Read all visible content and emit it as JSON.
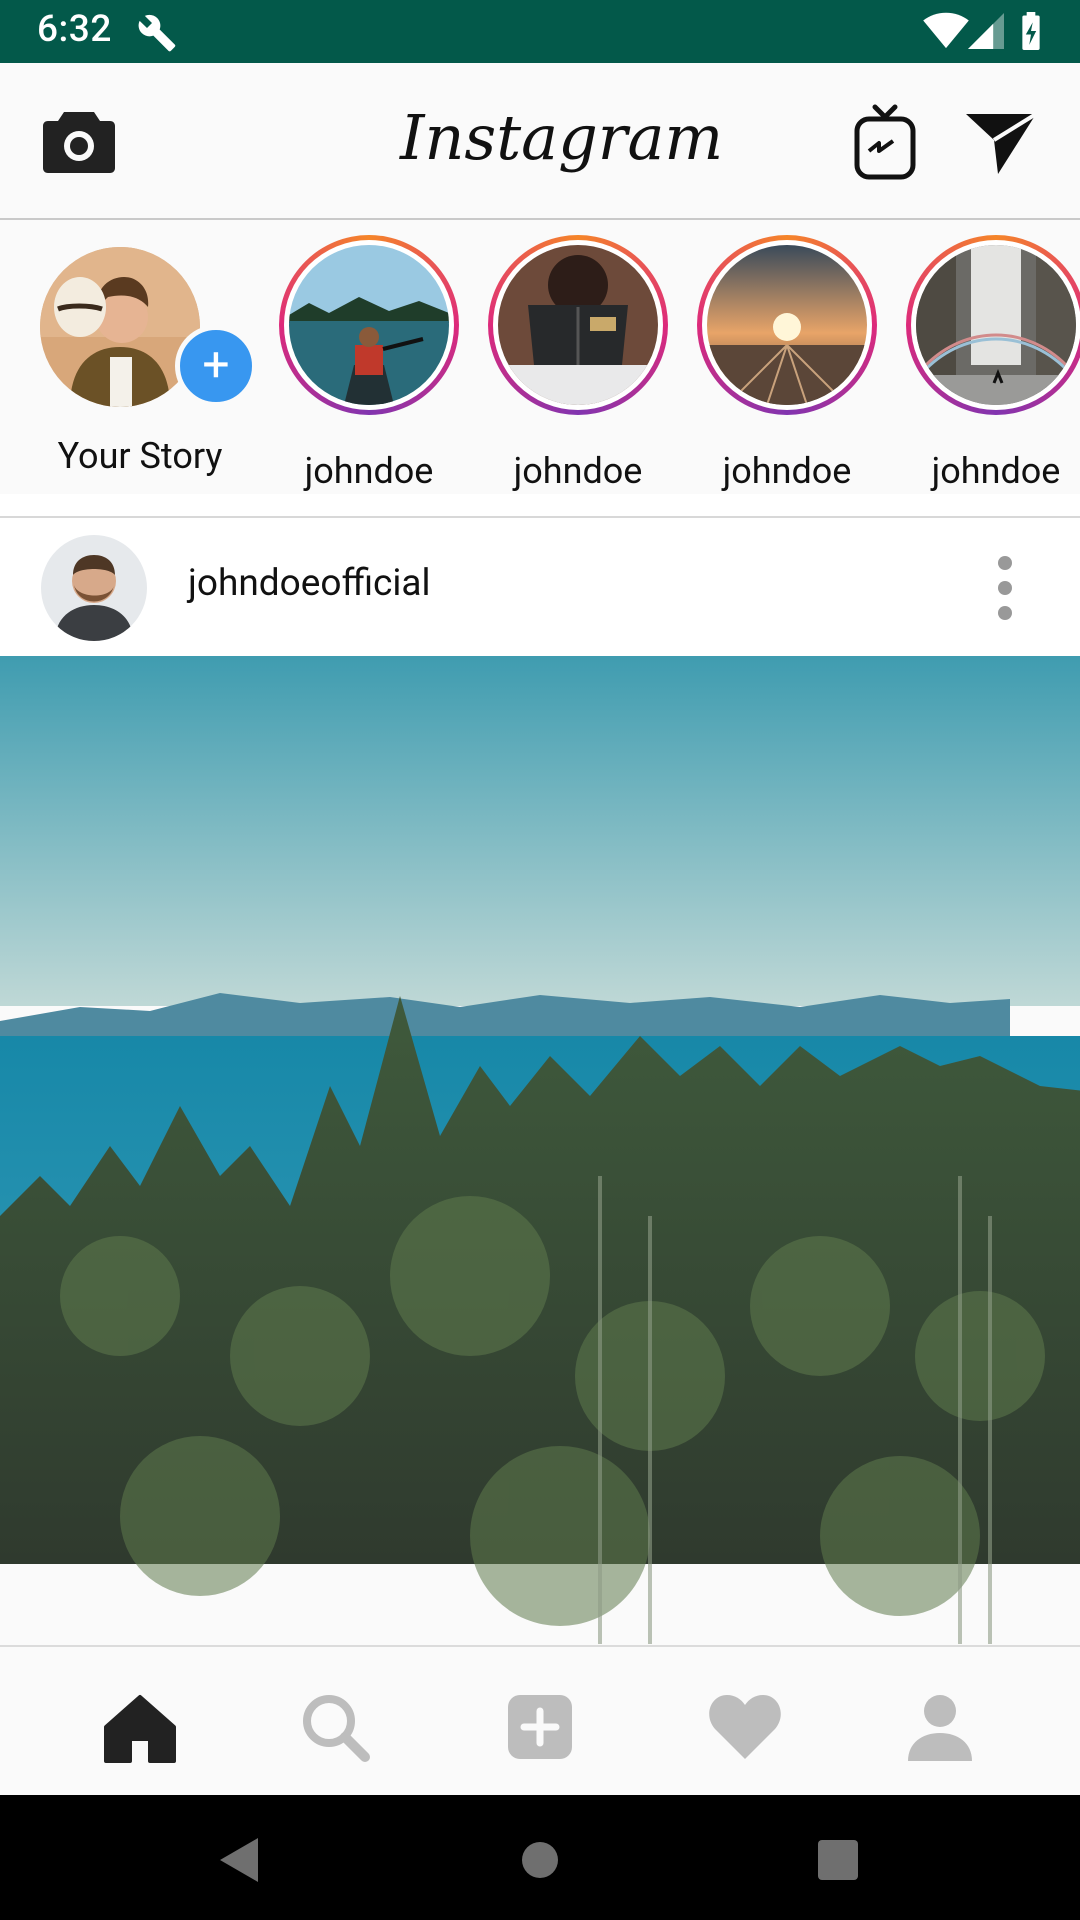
{
  "status_bar": {
    "time": "6:32"
  },
  "header": {
    "logo_text": "Instagram"
  },
  "stories": {
    "your_story_label": "Your Story",
    "items": [
      {
        "username": "johndoe"
      },
      {
        "username": "johndoe"
      },
      {
        "username": "johndoe"
      },
      {
        "username": "johndoe"
      }
    ]
  },
  "post": {
    "username": "johndoeofficial"
  },
  "colors": {
    "status_bar": "#03594a",
    "accent_blue": "#3897f0",
    "story_ring_start": "#f58529",
    "story_ring_end": "#dd2a7b"
  },
  "icons": {
    "header": [
      "camera-icon",
      "igtv-icon",
      "direct-message-icon"
    ],
    "bottom_nav": [
      "home-icon",
      "search-icon",
      "add-post-icon",
      "activity-heart-icon",
      "profile-icon"
    ],
    "system_nav": [
      "back-icon",
      "home-circle-icon",
      "recents-icon"
    ]
  }
}
